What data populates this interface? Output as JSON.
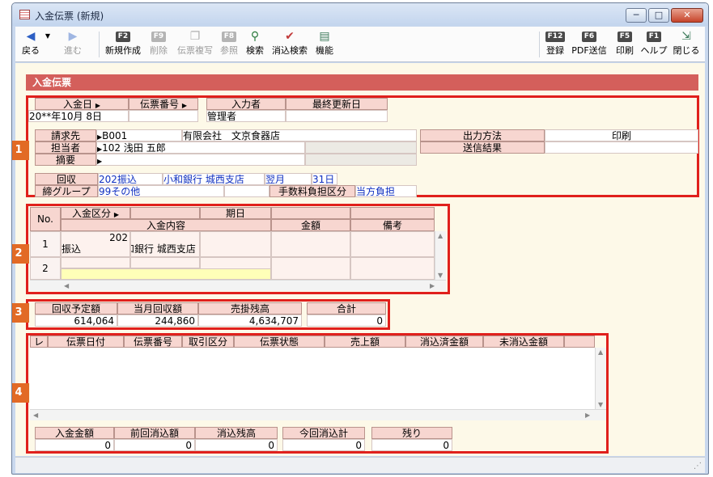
{
  "window": {
    "title": "入金伝票 (新規)",
    "min": "─",
    "max": "□",
    "close": "✕"
  },
  "toolbar": {
    "back": "戻る",
    "forward": "進む",
    "new_key": "F2",
    "new": "新規作成",
    "delete_key": "F9",
    "delete": "削除",
    "copy_key": "",
    "copy": "伝票複写",
    "ref_key": "F8",
    "ref": "参照",
    "search": "検索",
    "clear_search": "消込検索",
    "func": "機能",
    "reg_key": "F12",
    "reg": "登録",
    "pdf_key": "F6",
    "pdf": "PDF送信",
    "print_key": "F5",
    "print": "印刷",
    "help_key": "F1",
    "help": "ヘルプ",
    "close": "閉じる"
  },
  "section_title": "入金伝票",
  "badges": [
    "1",
    "2",
    "3",
    "4"
  ],
  "header": {
    "date_label": "入金日",
    "slip_label": "伝票番号",
    "inputter_label": "入力者",
    "updated_label": "最終更新日",
    "date_value": "20**年10月 8日",
    "slip_value": "",
    "inputter_value": "管理者",
    "updated_value": ""
  },
  "customer": {
    "billing_label": "請求先",
    "billing_code": "B001",
    "billing_name": "有限会社　文京食器店",
    "staff_label": "担当者",
    "staff_value": "102 浅田 五郎",
    "memo_label": "摘要",
    "memo_value": "",
    "output_label": "出力方法",
    "output_value": "印刷",
    "send_label": "送信結果",
    "send_value": ""
  },
  "collection": {
    "label": "回収",
    "method_code": "202",
    "method": "振込",
    "bank": "小和銀行 城西支店",
    "month": "翌月",
    "day": "31",
    "day_unit": "日",
    "group_label": "締グループ",
    "group_code": "99",
    "group": "その他",
    "fee_label": "手数料負担区分",
    "fee_value": "当方負担"
  },
  "detail": {
    "col_no": "No.",
    "col_type": "入金区分",
    "col_due": "期日",
    "col_content": "入金内容",
    "col_amount": "金額",
    "col_note": "備考",
    "row1_no": "1",
    "row1_code": "202",
    "row1_type": "振込",
    "row1_bank": "小和銀行 城西支店",
    "row2_no": "2"
  },
  "totals": {
    "plan_label": "回収予定額",
    "month_label": "当月回収額",
    "balance_label": "売掛残高",
    "total_label": "合計",
    "plan": "614,064",
    "month": "244,860",
    "balance": "4,634,707",
    "total": "0"
  },
  "reconcile": {
    "col_check": "レ",
    "col_date": "伝票日付",
    "col_slip": "伝票番号",
    "col_kind": "取引区分",
    "col_status": "伝票状態",
    "col_sales": "売上額",
    "col_cleared": "消込済金額",
    "col_uncleared": "未消込金額"
  },
  "summary": {
    "deposit_label": "入金金額",
    "prev_label": "前回消込額",
    "remain_label": "消込残高",
    "now_label": "今回消込計",
    "left_label": "残り",
    "deposit": "0",
    "prev": "0",
    "remain": "0",
    "now": "0",
    "left": "0"
  }
}
